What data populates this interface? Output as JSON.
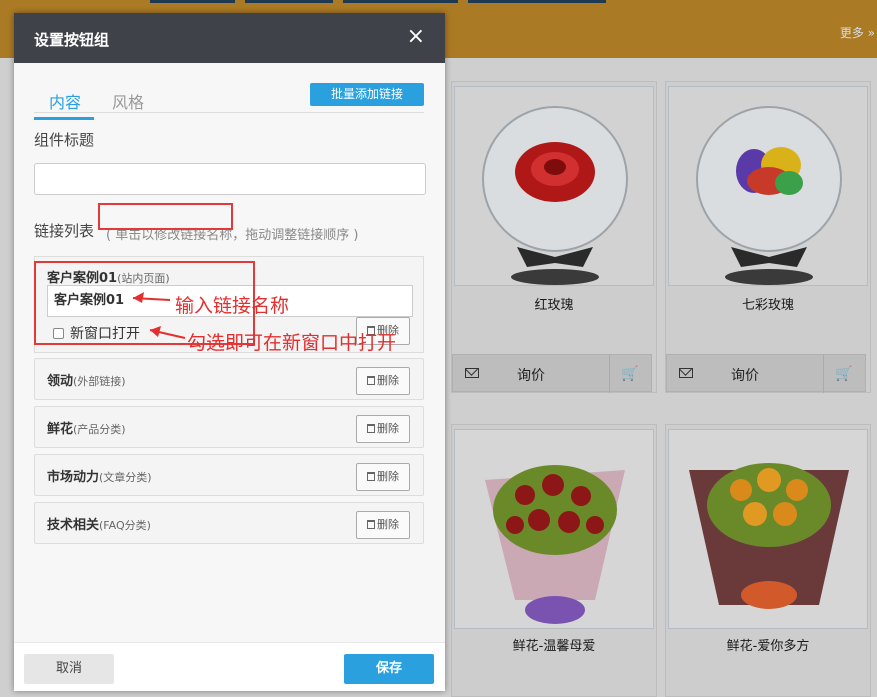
{
  "background": {
    "more_label": "更多 »",
    "products": [
      {
        "name": "红玫瑰",
        "inquiry_label": "询价"
      },
      {
        "name": "七彩玫瑰",
        "inquiry_label": "询价"
      },
      {
        "name": "鲜花-温馨母爱"
      },
      {
        "name": "鲜花-爱你多方"
      }
    ]
  },
  "modal": {
    "title": "设置按钮组",
    "close_symbol": "×",
    "tabs": [
      {
        "label": "内容"
      },
      {
        "label": "风格"
      }
    ],
    "batch_add_label": "批量添加链接",
    "component_title_label": "组件标题",
    "component_title_value": "",
    "link_list_label": "链接列表",
    "link_list_hint": "( 单击以修改链接名称，拖动调整链接顺序 )",
    "expanded_item": {
      "name": "客户案例01",
      "type": "(站内页面)",
      "input_value": "客户案例01",
      "new_window_label": "新窗口打开",
      "delete_label": "删除"
    },
    "items": [
      {
        "name": "领动",
        "type": "(外部链接)",
        "delete_label": "删除"
      },
      {
        "name": "鲜花",
        "type": "(产品分类)",
        "delete_label": "删除"
      },
      {
        "name": "市场动力",
        "type": "(文章分类)",
        "delete_label": "删除"
      },
      {
        "name": "技术相关",
        "type": "(FAQ分类)",
        "delete_label": "删除"
      }
    ],
    "cancel_label": "取消",
    "save_label": "保存"
  },
  "annotations": {
    "input_name": "输入链接名称",
    "check_new_window": "勾选即可在新窗口中打开"
  },
  "colors": {
    "accent": "#2aa0df",
    "header": "#3f4349",
    "annotation": "#e52e2e",
    "top_bar": "#ab7a24"
  }
}
